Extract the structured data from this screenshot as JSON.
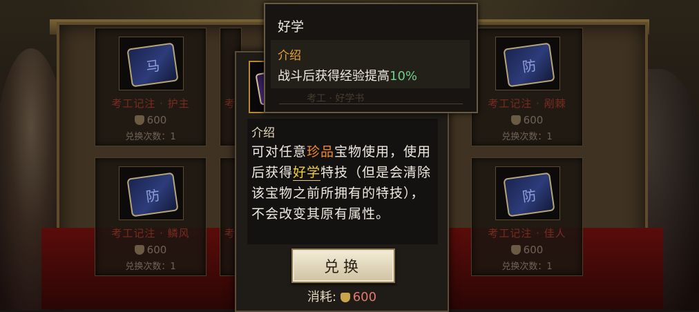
{
  "shop": {
    "cards": [
      {
        "name": "考工记注 · 护主",
        "price": "600",
        "limit": "兑换次数：1",
        "glyph": "马"
      },
      {
        "name": "考工记注 · 剐棘",
        "price": "600",
        "limit": "兑换次数：1",
        "glyph": "防"
      },
      {
        "name": "考工记注 · 鳞风",
        "price": "600",
        "limit": "兑换次数：1",
        "glyph": "防"
      },
      {
        "name": "考工记注 · 佳人",
        "price": "600",
        "limit": "兑换次数：1",
        "glyph": "防"
      }
    ],
    "partial_left": "考",
    "icon": "shield-coin-icon"
  },
  "detail": {
    "ghost_text": "考工 · 好学书",
    "intro_heading": "介绍",
    "desc_1": "可对任意",
    "desc_quality": "珍品",
    "desc_2": "宝物使用，使用后获得",
    "desc_skill": "好学",
    "desc_3": "特技（但是会清除该宝物之前所拥有的特技），不会改变其原有属性。",
    "exchange_label": "兑换",
    "cost_label": "消耗:",
    "cost_value": "600",
    "colors": {
      "quality": "#ee8a2c",
      "skill": "#f2d23a",
      "cost": "#e07a72"
    }
  },
  "tooltip": {
    "title": "好学",
    "intro_heading": "介绍",
    "effect_text": "战斗后获得经验提高",
    "effect_value": "10%",
    "colors": {
      "heading": "#e8a33a",
      "value": "#6fd08a"
    }
  }
}
